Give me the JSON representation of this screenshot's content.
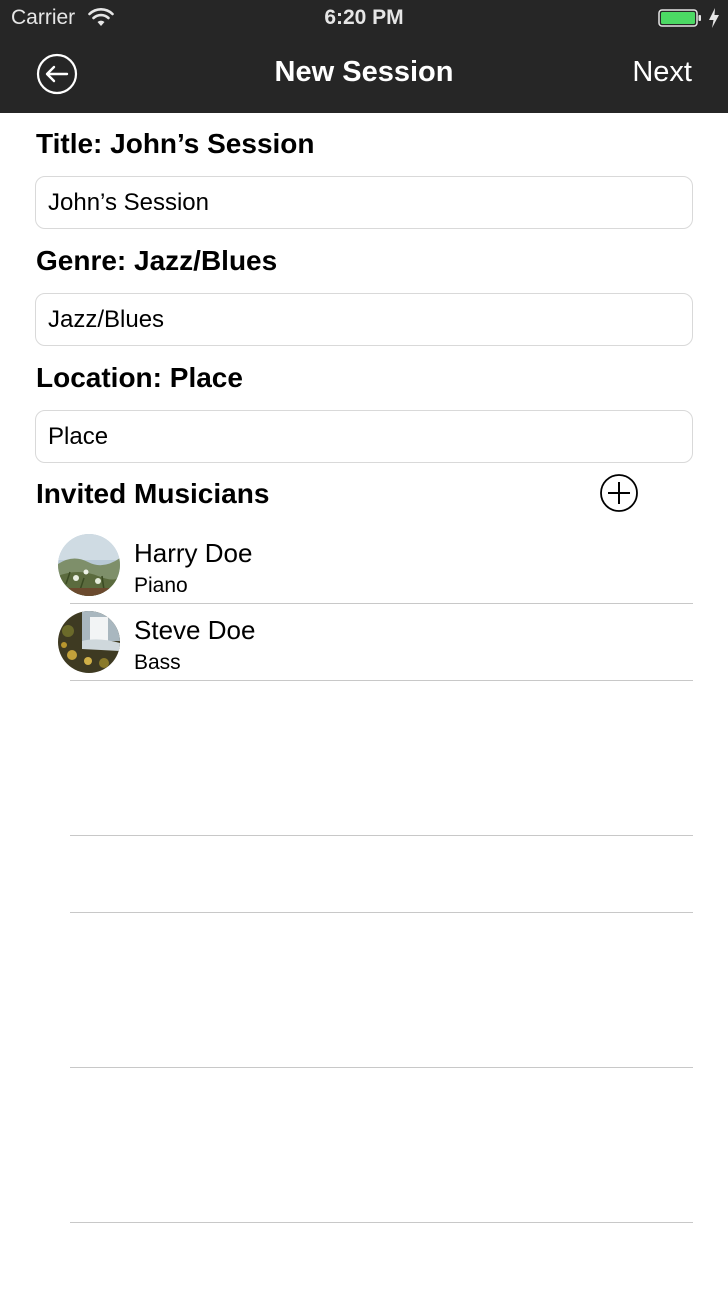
{
  "status_bar": {
    "carrier": "Carrier",
    "time": "6:20 PM",
    "battery_color": "#4cd964"
  },
  "nav": {
    "title": "New Session",
    "next_label": "Next",
    "background": "#262626",
    "back_icon": "back-arrow-circle-icon"
  },
  "form": {
    "title": {
      "label": "Title: John’s Session",
      "value": "John’s Session"
    },
    "genre": {
      "label": "Genre: Jazz/Blues",
      "value": "Jazz/Blues"
    },
    "location": {
      "label": "Location: Place",
      "value": "Place"
    }
  },
  "musicians": {
    "heading": "Invited Musicians",
    "add_icon": "plus-circle-icon",
    "items": [
      {
        "name": "Harry Doe",
        "instrument": "Piano"
      },
      {
        "name": "Steve Doe",
        "instrument": "Bass"
      }
    ]
  }
}
